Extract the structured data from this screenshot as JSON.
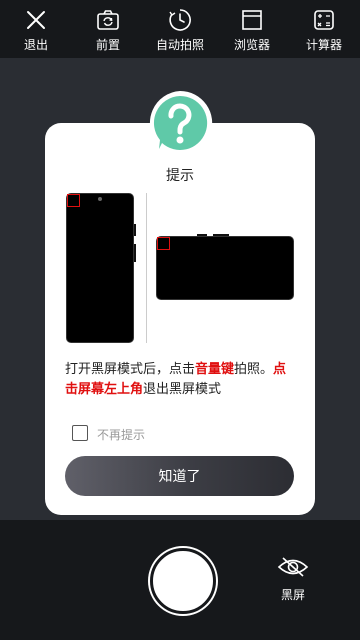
{
  "toolbar": {
    "items": [
      {
        "icon": "close-icon",
        "label": "退出"
      },
      {
        "icon": "flip-camera-icon",
        "label": "前置"
      },
      {
        "icon": "timer-icon",
        "label": "自动拍照"
      },
      {
        "icon": "browser-icon",
        "label": "浏览器"
      },
      {
        "icon": "calculator-icon",
        "label": "计算器"
      }
    ]
  },
  "dialog": {
    "badge_icon": "question-icon",
    "title": "提示",
    "desc_1": "打开黑屏模式后，点击",
    "desc_hl_1": "音量键",
    "desc_2": "拍照。",
    "desc_hl_2": "点击屏幕左上角",
    "desc_3": "退出黑屏模式",
    "checkbox_label": "不再提示",
    "checkbox_checked": false,
    "ok_label": "知道了"
  },
  "bottom": {
    "shutter_icon": "shutter-button",
    "black_screen_icon": "eye-off-icon",
    "black_screen_label": "黑屏"
  },
  "colors": {
    "accent_green": "#5fc9a8",
    "highlight_red": "#e01010",
    "bar_dark": "#16181b"
  }
}
